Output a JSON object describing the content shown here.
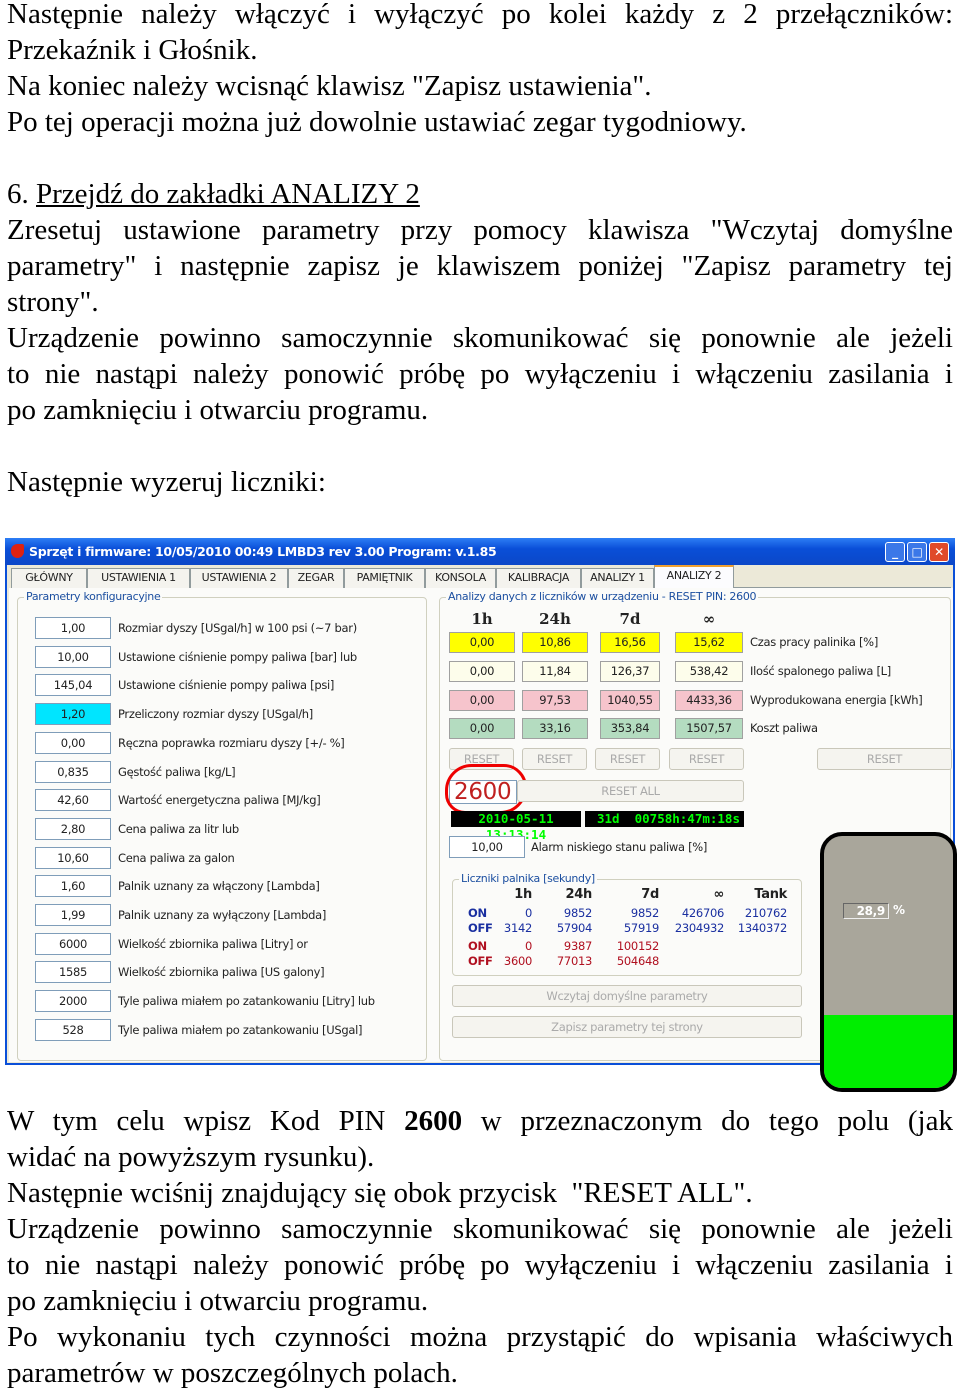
{
  "text_top": {
    "l1": "Następnie należy włączyć i wyłączyć po kolei każdy z 2 przełączników:",
    "l2": "Przekaźnik i Głośnik.",
    "l3": "Na koniec należy wcisnąć klawisz \"Zapisz ustawienia\".",
    "l4": "Po tej operacji można już dowolnie ustawiać zegar tygodniowy.",
    "step_num": "6. ",
    "step_link": "Przejdź do zakładki ANALIZY 2",
    "l6": "Zresetuj ustawione parametry przy pomocy klawisza \"Wczytaj domyślne",
    "l7": "parametry\" i następnie zapisz je klawiszem poniżej \"Zapisz parametry tej",
    "l8": "strony\".",
    "l9": "Urządzenie powinno samoczynnie skomunikować się ponownie ale jeżeli",
    "l10": "to nie nastąpi należy ponowić próbę po wyłączeniu i włączeniu zasilania i",
    "l11": "po zamknięciu i otwarciu programu.",
    "l12": "Następnie wyzeruj liczniki:"
  },
  "text_bottom": {
    "l1a": "W tym celu wpisz Kod PIN ",
    "l1b": "2600",
    "l1c": " w przeznaczonym do tego polu (jak",
    "l2": "widać na powyższym rysunku).",
    "l3": "Następnie wciśnij znajdujący się obok przycisk  \"RESET ALL\".",
    "l4": "Urządzenie powinno samoczynnie skomunikować się ponownie ale jeżeli",
    "l5": "to nie nastąpi należy ponowić próbę po wyłączeniu i włączeniu zasilania i",
    "l6": "po zamknięciu i otwarciu programu.",
    "l7": "Po wykonaniu tych czynności można przystąpić do wpisania właściwych",
    "l8": "parametrów w poszczególnych polach."
  },
  "window": {
    "title": "Sprzęt i firmware: 10/05/2010 00:49   LMBD3 rev 3.00   Program: v.1.85",
    "tabs": [
      "GŁÓWNY",
      "USTAWIENIA 1",
      "USTAWIENIA 2",
      "ZEGAR",
      "PAMIĘTNIK",
      "KONSOLA",
      "KALIBRACJA",
      "ANALIZY 1",
      "ANALIZY 2"
    ],
    "active_tab": "ANALIZY 2",
    "config": {
      "title": "Parametry konfiguracyjne",
      "rows": [
        {
          "value": "1,00",
          "label": "Rozmiar dyszy [USgal/h] w 100 psi (~7 bar)"
        },
        {
          "value": "10,00",
          "label": "Ustawione ciśnienie pompy paliwa [bar] lub"
        },
        {
          "value": "145,04",
          "label": "Ustawione ciśnienie pompy paliwa [psi]"
        },
        {
          "value": "1,20",
          "label": "Przeliczony rozmiar dyszy [USgal/h]",
          "highlight": "#00e5ff"
        },
        {
          "value": "0,00",
          "label": "Ręczna poprawka rozmiaru dyszy [+/- %]"
        },
        {
          "value": "0,835",
          "label": "Gęstość paliwa [kg/L]"
        },
        {
          "value": "42,60",
          "label": "Wartość energetyczna paliwa [MJ/kg]"
        },
        {
          "value": "2,80",
          "label": "Cena paliwa za litr lub"
        },
        {
          "value": "10,60",
          "label": "Cena paliwa za galon"
        },
        {
          "value": "1,60",
          "label": "Palnik uznany za włączony [Lambda]"
        },
        {
          "value": "1,99",
          "label": "Palnik uznany za wyłączony [Lambda]"
        },
        {
          "value": "6000",
          "label": "Wielkość zbiornika paliwa [Litry] or"
        },
        {
          "value": "1585",
          "label": "Wielkość zbiornika paliwa [US galony]"
        },
        {
          "value": "2000",
          "label": "Tyle paliwa miałem po zatankowaniu [Litry] lub"
        },
        {
          "value": "528",
          "label": "Tyle paliwa miałem po zatankowaniu [USgal]"
        }
      ]
    },
    "analysis": {
      "title": "Analizy danych z liczników w urządzeniu - RESET PIN: 2600",
      "headers": [
        "1h",
        "24h",
        "7d",
        "∞"
      ],
      "rows": [
        {
          "label": "Czas pracy palinika [%]",
          "values": [
            "0,00",
            "10,86",
            "16,56",
            "15,62"
          ],
          "color": "#ffff00"
        },
        {
          "label": "Ilość spalonego paliwa [L]",
          "values": [
            "0,00",
            "11,84",
            "126,37",
            "538,42"
          ],
          "color": "#fdfdeb"
        },
        {
          "label": "Wyprodukowana energia [kWh]",
          "values": [
            "0,00",
            "97,53",
            "1040,55",
            "4433,36"
          ],
          "color": "#f6c4cc"
        },
        {
          "label": "Koszt paliwa",
          "values": [
            "0,00",
            "33,16",
            "353,84",
            "1507,57"
          ],
          "color": "#b4dcc0"
        }
      ],
      "reset_label": "RESET",
      "pin_value": "2600",
      "reset_all_label": "RESET ALL",
      "datetime": "2010-05-11 13:13:14",
      "uptime": "31d  00758h:47m:18s",
      "alarm_value": "10,00",
      "alarm_label": "Alarm niskiego stanu paliwa [%]",
      "counters": {
        "title": "Liczniki palnika [sekundy]",
        "headers": [
          "1h",
          "24h",
          "7d",
          "∞",
          "Tank"
        ],
        "rows": [
          {
            "label": "ON",
            "values": [
              "0",
              "9852",
              "9852",
              "426706",
              "210762"
            ],
            "color": "#1a2fa0"
          },
          {
            "label": "OFF",
            "values": [
              "3142",
              "57904",
              "57919",
              "2304932",
              "1340372"
            ],
            "color": "#1a2fa0"
          },
          {
            "label": "ON",
            "values": [
              "0",
              "9387",
              "100152",
              "",
              ""
            ],
            "color": "#b01020"
          },
          {
            "label": "OFF",
            "values": [
              "3600",
              "77013",
              "504648",
              "",
              ""
            ],
            "color": "#b01020"
          }
        ]
      },
      "load_defaults_label": "Wczytaj domyślne parametry",
      "save_page_label": "Zapisz parametry tej strony",
      "tank_percent": "28,9",
      "tank_unit": "%",
      "tank_level": 28.9
    }
  }
}
